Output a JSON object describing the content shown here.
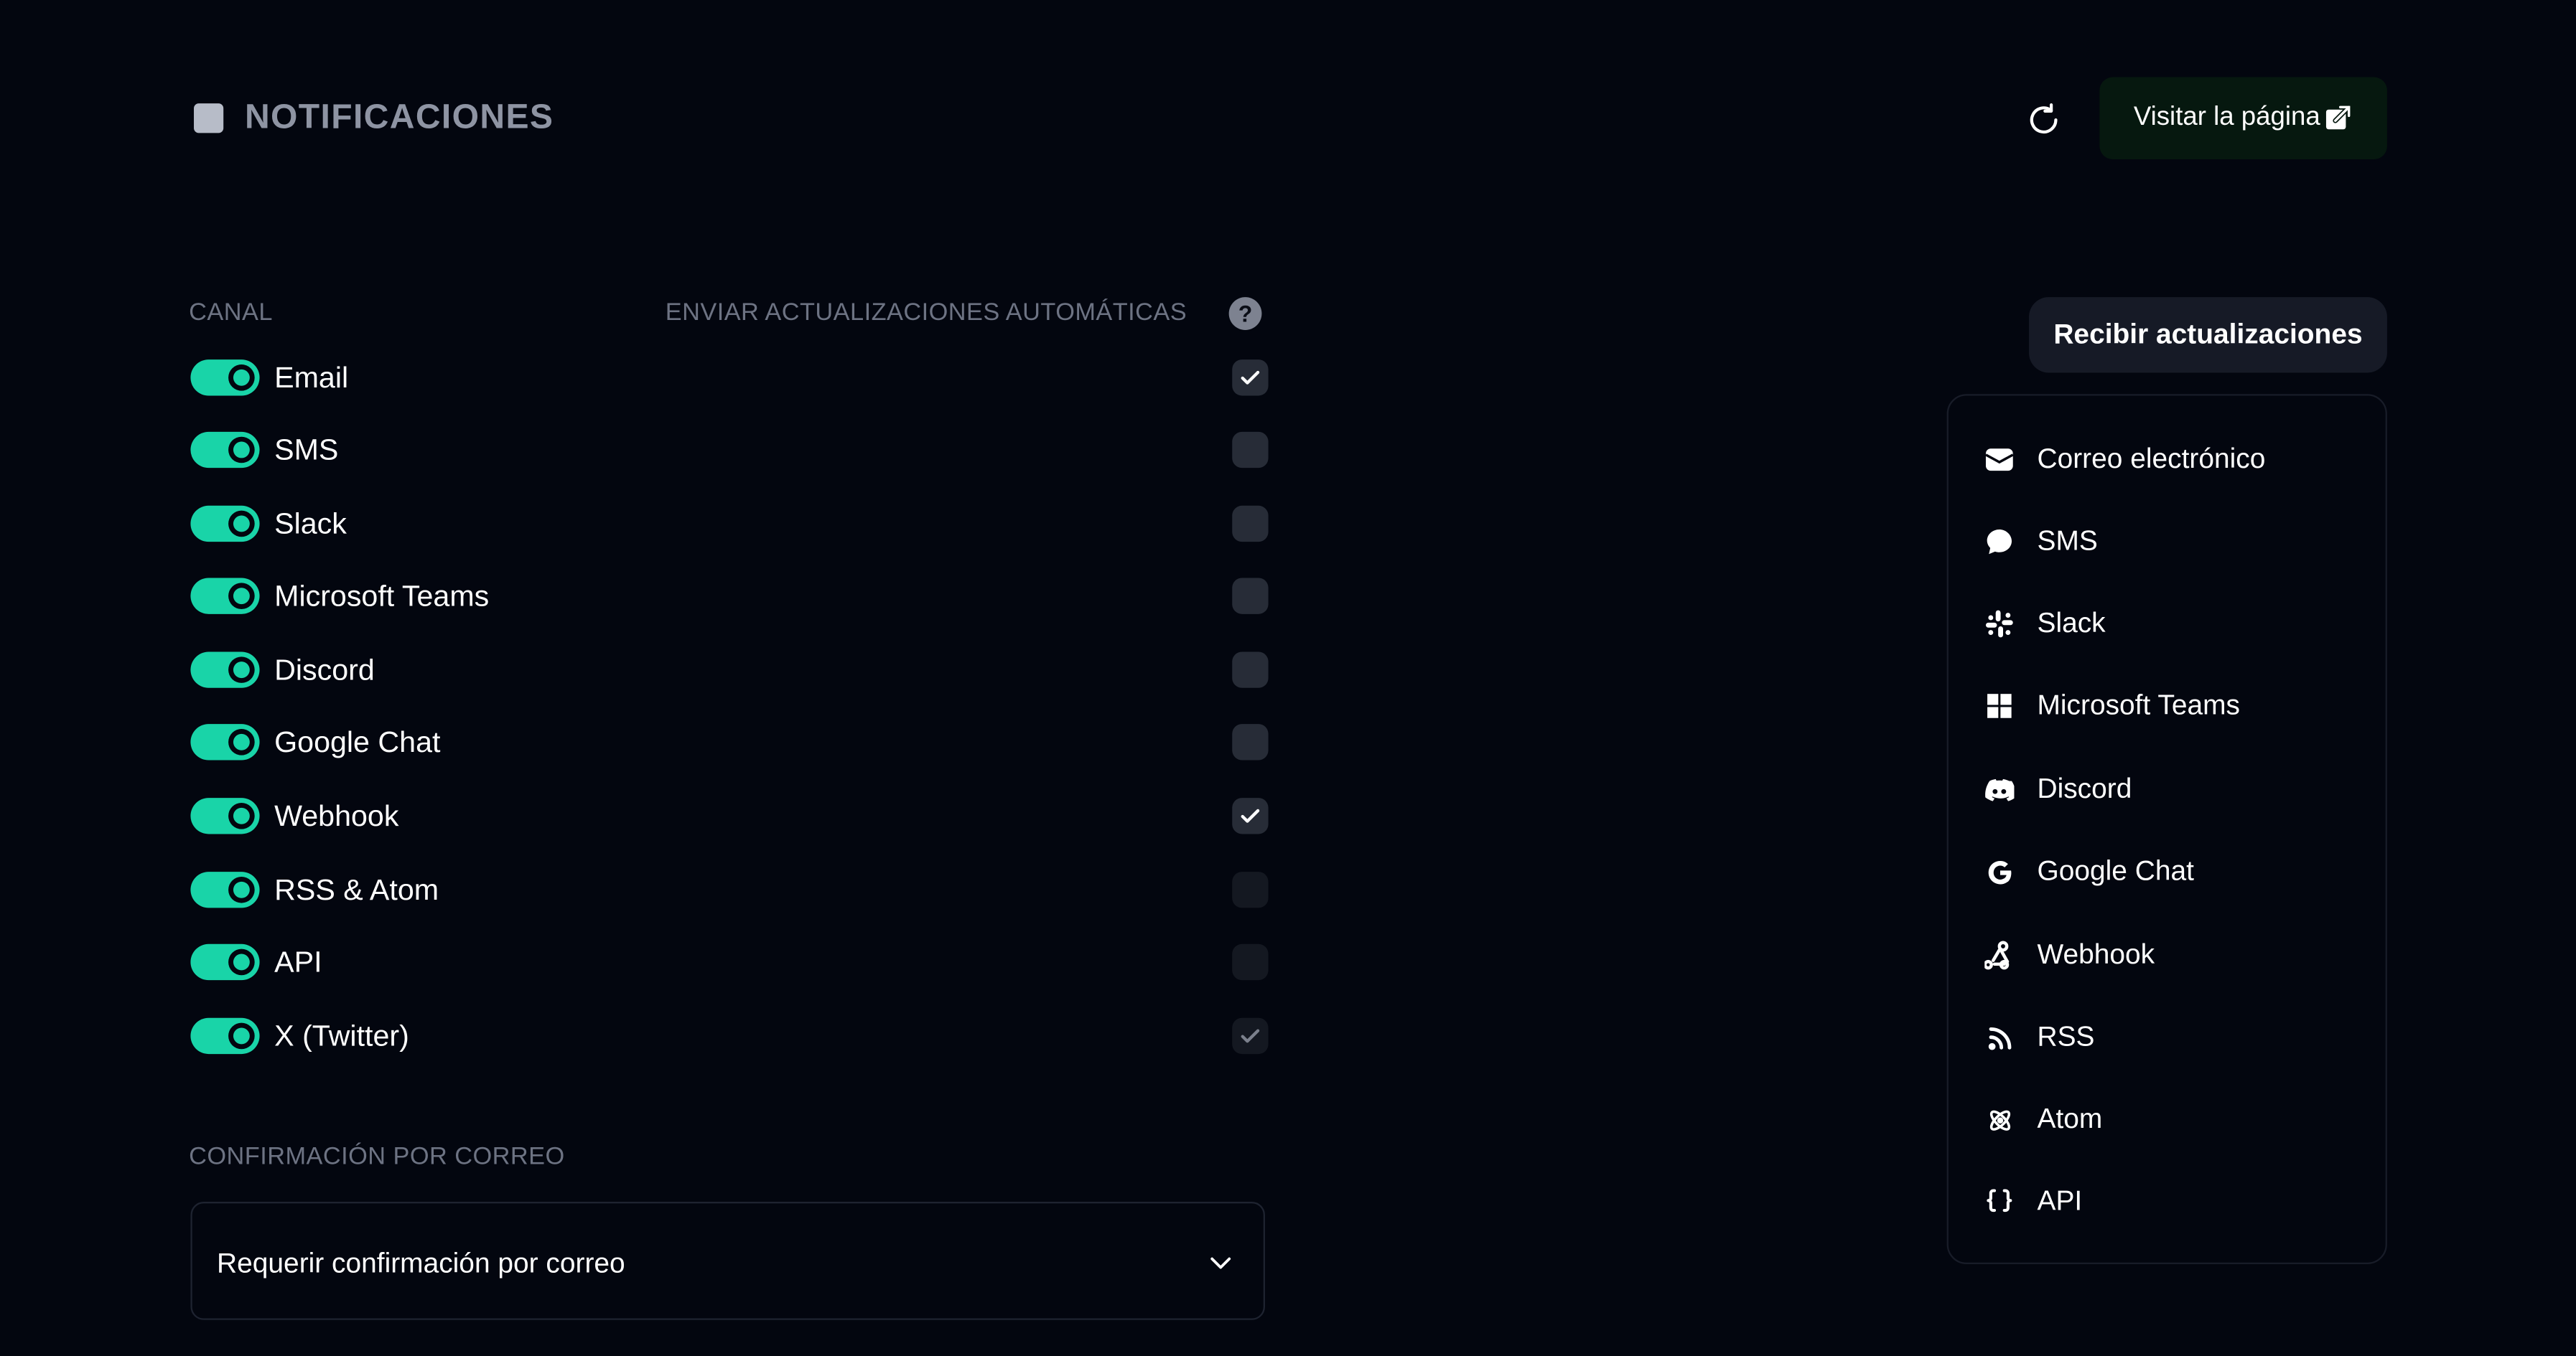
{
  "header": {
    "title": "NOTIFICACIONES",
    "visit_label": "Visitar la página"
  },
  "channels": {
    "col_channel": "CANAL",
    "col_auto": "ENVIAR ACTUALIZACIONES AUTOMÁTICAS",
    "help_glyph": "?",
    "items": [
      {
        "label": "Email",
        "enabled": true,
        "auto": true
      },
      {
        "label": "SMS",
        "enabled": true,
        "auto": false
      },
      {
        "label": "Slack",
        "enabled": true,
        "auto": false
      },
      {
        "label": "Microsoft Teams",
        "enabled": true,
        "auto": false
      },
      {
        "label": "Discord",
        "enabled": true,
        "auto": false
      },
      {
        "label": "Google Chat",
        "enabled": true,
        "auto": false
      },
      {
        "label": "Webhook",
        "enabled": true,
        "auto": true
      },
      {
        "label": "RSS & Atom",
        "enabled": true,
        "auto": false
      },
      {
        "label": "API",
        "enabled": true,
        "auto": false
      },
      {
        "label": "X (Twitter)",
        "enabled": true,
        "auto": true
      }
    ]
  },
  "confirmation": {
    "label": "CONFIRMACIÓN POR CORREO",
    "selected": "Requerir confirmación por correo"
  },
  "subscribe": {
    "button_label": "Recibir actualizaciones",
    "items": [
      {
        "label": "Correo electrónico",
        "icon": "envelope-icon"
      },
      {
        "label": "SMS",
        "icon": "chat-bubble-icon"
      },
      {
        "label": "Slack",
        "icon": "slack-icon"
      },
      {
        "label": "Microsoft Teams",
        "icon": "windows-icon"
      },
      {
        "label": "Discord",
        "icon": "discord-icon"
      },
      {
        "label": "Google Chat",
        "icon": "google-icon"
      },
      {
        "label": "Webhook",
        "icon": "webhook-icon"
      },
      {
        "label": "RSS",
        "icon": "rss-icon"
      },
      {
        "label": "Atom",
        "icon": "atom-icon"
      },
      {
        "label": "API",
        "icon": "braces-icon"
      }
    ]
  },
  "colors": {
    "background": "#03060f",
    "accent": "#19d4a8",
    "muted_text": "#6d7383"
  }
}
